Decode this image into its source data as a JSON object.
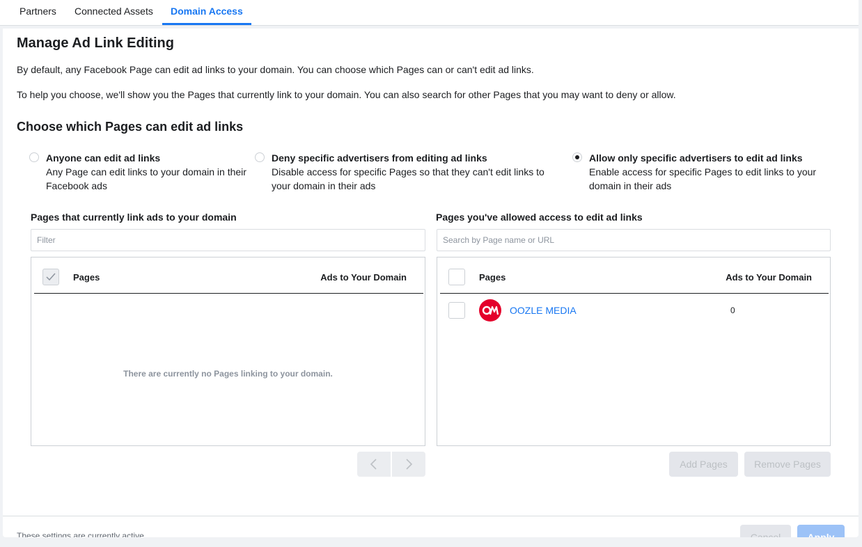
{
  "tabs": [
    {
      "label": "Partners",
      "active": false
    },
    {
      "label": "Connected Assets",
      "active": false
    },
    {
      "label": "Domain Access",
      "active": true
    }
  ],
  "main": {
    "title": "Manage Ad Link Editing",
    "intro_1": "By default, any Facebook Page can edit ad links to your domain. You can choose which Pages can or can't edit ad links.",
    "intro_2": "To help you choose, we'll show you the Pages that currently link to your domain. You can also search for other Pages that you may want to deny or allow.",
    "choose_title": "Choose which Pages can edit ad links"
  },
  "options": [
    {
      "title": "Anyone can edit ad links",
      "desc": "Any Page can edit links to your domain in their Facebook ads",
      "selected": false
    },
    {
      "title": "Deny specific advertisers from editing ad links",
      "desc": "Disable access for specific Pages so that they can't edit links to your domain in their ads",
      "selected": false
    },
    {
      "title": "Allow only specific advertisers to edit ad links",
      "desc": "Enable access for specific Pages to edit links to your domain in their ads",
      "selected": true
    }
  ],
  "left_panel": {
    "title": "Pages that currently link ads to your domain",
    "filter_placeholder": "Filter",
    "col_pages": "Pages",
    "col_ads": "Ads to Your Domain",
    "empty_text": "There are currently no Pages linking to your domain."
  },
  "right_panel": {
    "title": "Pages you've allowed access to edit ad links",
    "search_placeholder": "Search by Page name or URL",
    "col_pages": "Pages",
    "col_ads": "Ads to Your Domain",
    "rows": [
      {
        "name": "OOZLE MEDIA",
        "ads": "0",
        "logo_text": "OM"
      }
    ],
    "add_label": "Add Pages",
    "remove_label": "Remove Pages"
  },
  "footer": {
    "status": "These settings are currently active.",
    "cancel_label": "Cancel",
    "apply_label": "Apply"
  },
  "colors": {
    "accent": "#1877f2",
    "logo_red": "#e4002b"
  },
  "icons": {
    "prev": "chevron-left-icon",
    "next": "chevron-right-icon",
    "check": "check-icon"
  }
}
